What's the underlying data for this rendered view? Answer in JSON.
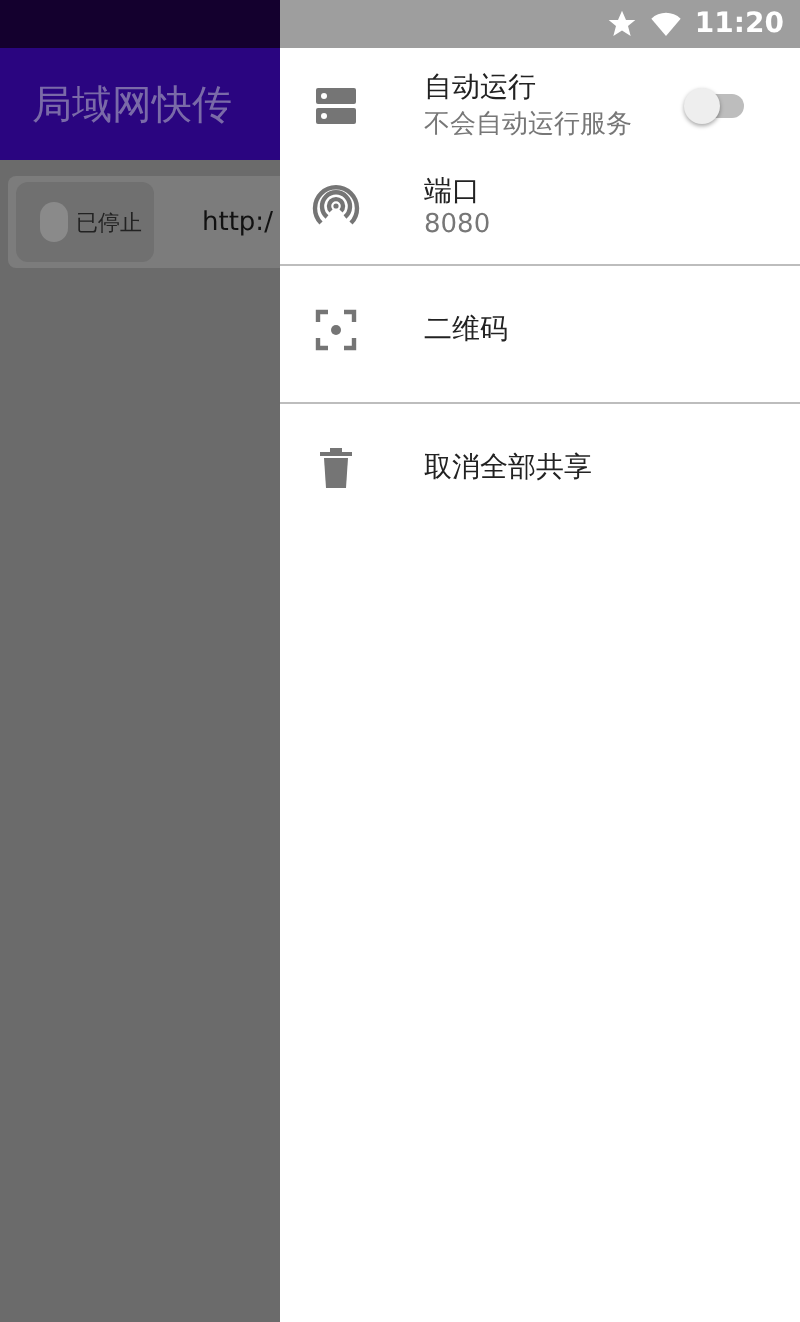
{
  "app": {
    "title": "局域网快传",
    "status_chip": {
      "label": "已停止",
      "on": false
    },
    "url": "http:/"
  },
  "status_bar": {
    "time": "11:20"
  },
  "drawer": {
    "items": [
      {
        "kind": "switch",
        "title": "自动运行",
        "subtitle": "不会自动运行服务",
        "on": false
      },
      {
        "kind": "info",
        "title": "端口",
        "subtitle": "8080"
      },
      {
        "kind": "divider"
      },
      {
        "kind": "action",
        "title": "二维码"
      },
      {
        "kind": "divider"
      },
      {
        "kind": "action",
        "title": "取消全部共享"
      }
    ]
  }
}
